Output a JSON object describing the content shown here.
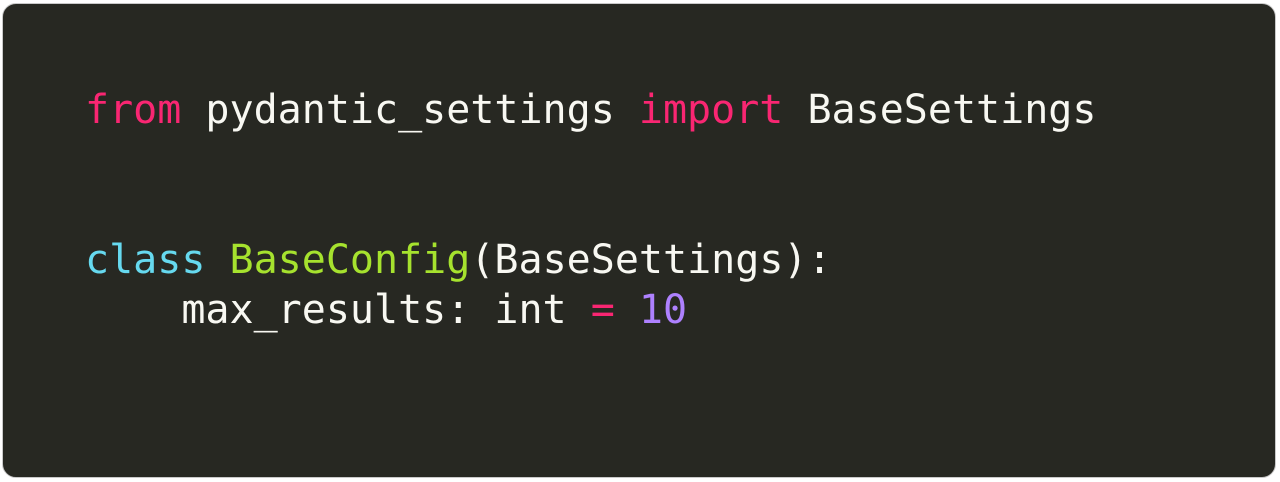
{
  "code": {
    "language": "python",
    "theme_colors": {
      "background": "#272822",
      "text": "#f8f8f2",
      "keyword": "#f92672",
      "storage": "#66d9ef",
      "class_name": "#a6e22e",
      "number": "#ae81ff"
    },
    "line1": {
      "kw_from": "from",
      "module": " pydantic_settings ",
      "kw_import": "import",
      "name": " BaseSettings"
    },
    "line4": {
      "kw_class": "class",
      "space": " ",
      "class_name": "BaseConfig",
      "bases": "(BaseSettings):"
    },
    "line5": {
      "field": "    max_results: int ",
      "op": "=",
      "space": " ",
      "value": "10"
    }
  }
}
